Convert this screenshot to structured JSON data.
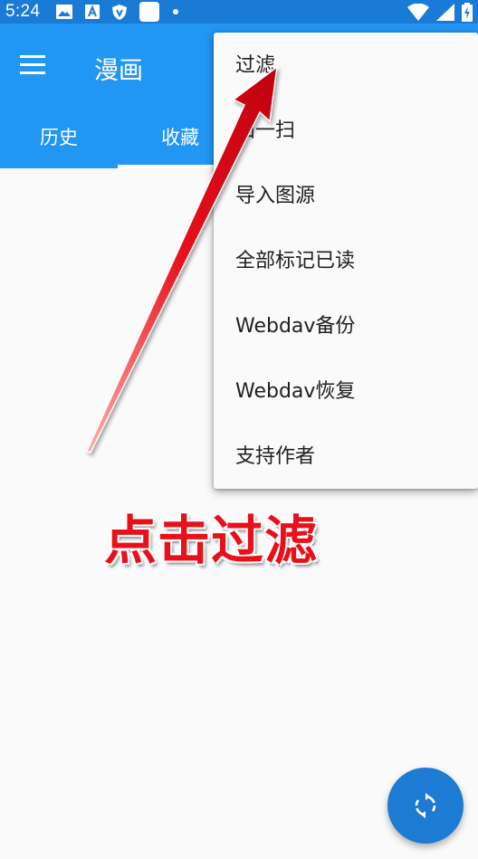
{
  "status_bar": {
    "time": "5:24",
    "icons": [
      "image-icon",
      "a-text-icon",
      "shield-icon",
      "app-square-icon",
      "dot-icon"
    ],
    "right_icons": [
      "wifi-icon",
      "signal-icon",
      "battery-charging-icon"
    ]
  },
  "app_bar": {
    "title": "漫画",
    "menu_icon": "hamburger-menu-icon"
  },
  "tabs": [
    {
      "label": "历史"
    },
    {
      "label": "收藏"
    }
  ],
  "overflow_menu": {
    "items": [
      {
        "label": "过滤"
      },
      {
        "label": "扫一扫"
      },
      {
        "label": "导入图源"
      },
      {
        "label": "全部标记已读"
      },
      {
        "label": "Webdav备份"
      },
      {
        "label": "Webdav恢复"
      },
      {
        "label": "支持作者"
      }
    ]
  },
  "annotation": {
    "text": "点击过滤",
    "color": "#e8101a"
  },
  "fab": {
    "icon": "sync-icon",
    "color": "#1e7bd3"
  },
  "colors": {
    "primary": "#2196f3",
    "status_bar": "#1a7bd6"
  }
}
